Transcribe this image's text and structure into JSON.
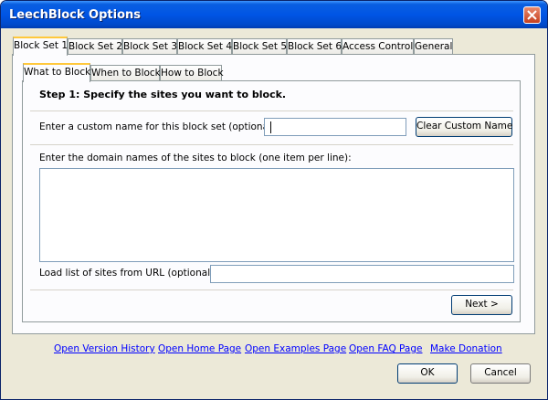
{
  "window": {
    "title": "LeechBlock Options"
  },
  "outer_tabs": [
    "Block Set 1",
    "Block Set 2",
    "Block Set 3",
    "Block Set 4",
    "Block Set 5",
    "Block Set 6",
    "Access Control",
    "General"
  ],
  "inner_tabs": [
    "What to Block",
    "When to Block",
    "How to Block"
  ],
  "content": {
    "step_title": "Step 1: Specify the sites you want to block.",
    "custom_name_label": "Enter a custom name for this block set (optional):",
    "custom_name_value": "",
    "clear_button": "Clear Custom Name",
    "domains_label": "Enter the domain names of the sites to block (one item per line):",
    "domains_value": "",
    "url_label": "Load list of sites from URL (optional):",
    "url_value": "",
    "next_button": "Next >"
  },
  "links": [
    "Open Version History",
    "Open Home Page",
    "Open Examples Page",
    "Open FAQ Page",
    "Make Donation"
  ],
  "footer": {
    "ok": "OK",
    "cancel": "Cancel"
  },
  "colors": {
    "titlebar": "#0055e5",
    "active_tab_accent": "#ffc83c",
    "link": "#0000ff"
  }
}
